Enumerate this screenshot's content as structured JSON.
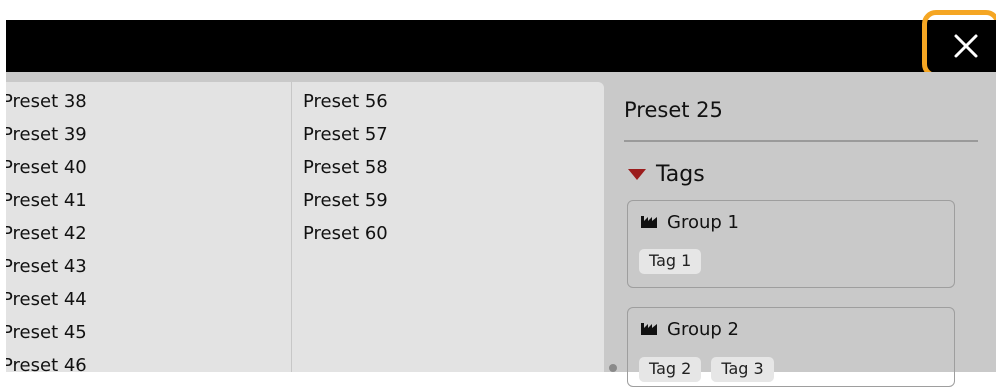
{
  "list": {
    "column1": [
      "Preset 38",
      "Preset 39",
      "Preset 40",
      "Preset 41",
      "Preset 42",
      "Preset 43",
      "Preset 44",
      "Preset 45",
      "Preset 46"
    ],
    "column2": [
      "Preset 56",
      "Preset 57",
      "Preset 58",
      "Preset 59",
      "Preset 60"
    ]
  },
  "detail": {
    "title": "Preset 25",
    "tags_label": "Tags",
    "groups": [
      {
        "name": "Group 1",
        "tags": [
          "Tag 1"
        ]
      },
      {
        "name": "Group 2",
        "tags": [
          "Tag 2",
          "Tag 3"
        ]
      }
    ]
  },
  "colors": {
    "close_highlight": "#f5a623",
    "tags_triangle": "#9b1c1c",
    "topbar": "#000000"
  },
  "icons": {
    "close": "close-icon",
    "expand": "triangle-down-icon",
    "group": "factory-icon"
  }
}
